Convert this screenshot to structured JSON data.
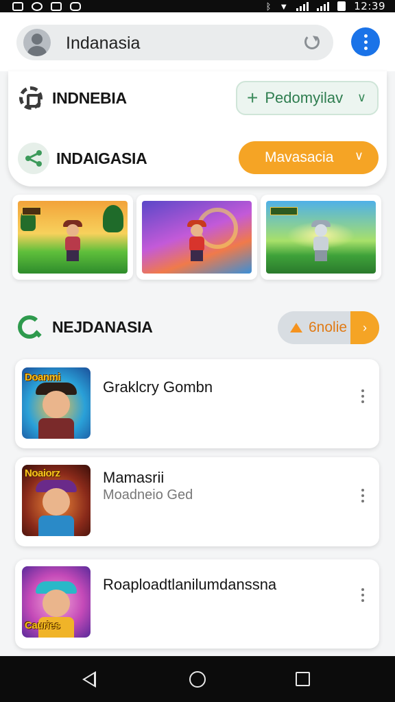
{
  "status_bar": {
    "time": "12:39"
  },
  "search": {
    "query": "Indanasia"
  },
  "section_one": {
    "row1": {
      "title": "INDNEBIA",
      "button_label": "Pedomyilav"
    },
    "row2": {
      "title": "INDAIGASIA",
      "button_label": "Mavasacia"
    }
  },
  "section_two": {
    "title": "NEJDANASIA",
    "button_label": "6nolie"
  },
  "games": [
    {
      "title": "Graklcry Gombn",
      "subtitle": "",
      "thumb_caption": "Doanmi"
    },
    {
      "title": "Mamasrii",
      "subtitle": "Moadneio Ged",
      "thumb_caption": "Noaiorz"
    },
    {
      "title": "Roaploadtlanilumdanssna",
      "subtitle": "",
      "thumb_caption": "Cauries"
    }
  ],
  "colors": {
    "accent_blue": "#1a73e8",
    "accent_orange": "#f5a425",
    "accent_green": "#2e9a4d"
  }
}
